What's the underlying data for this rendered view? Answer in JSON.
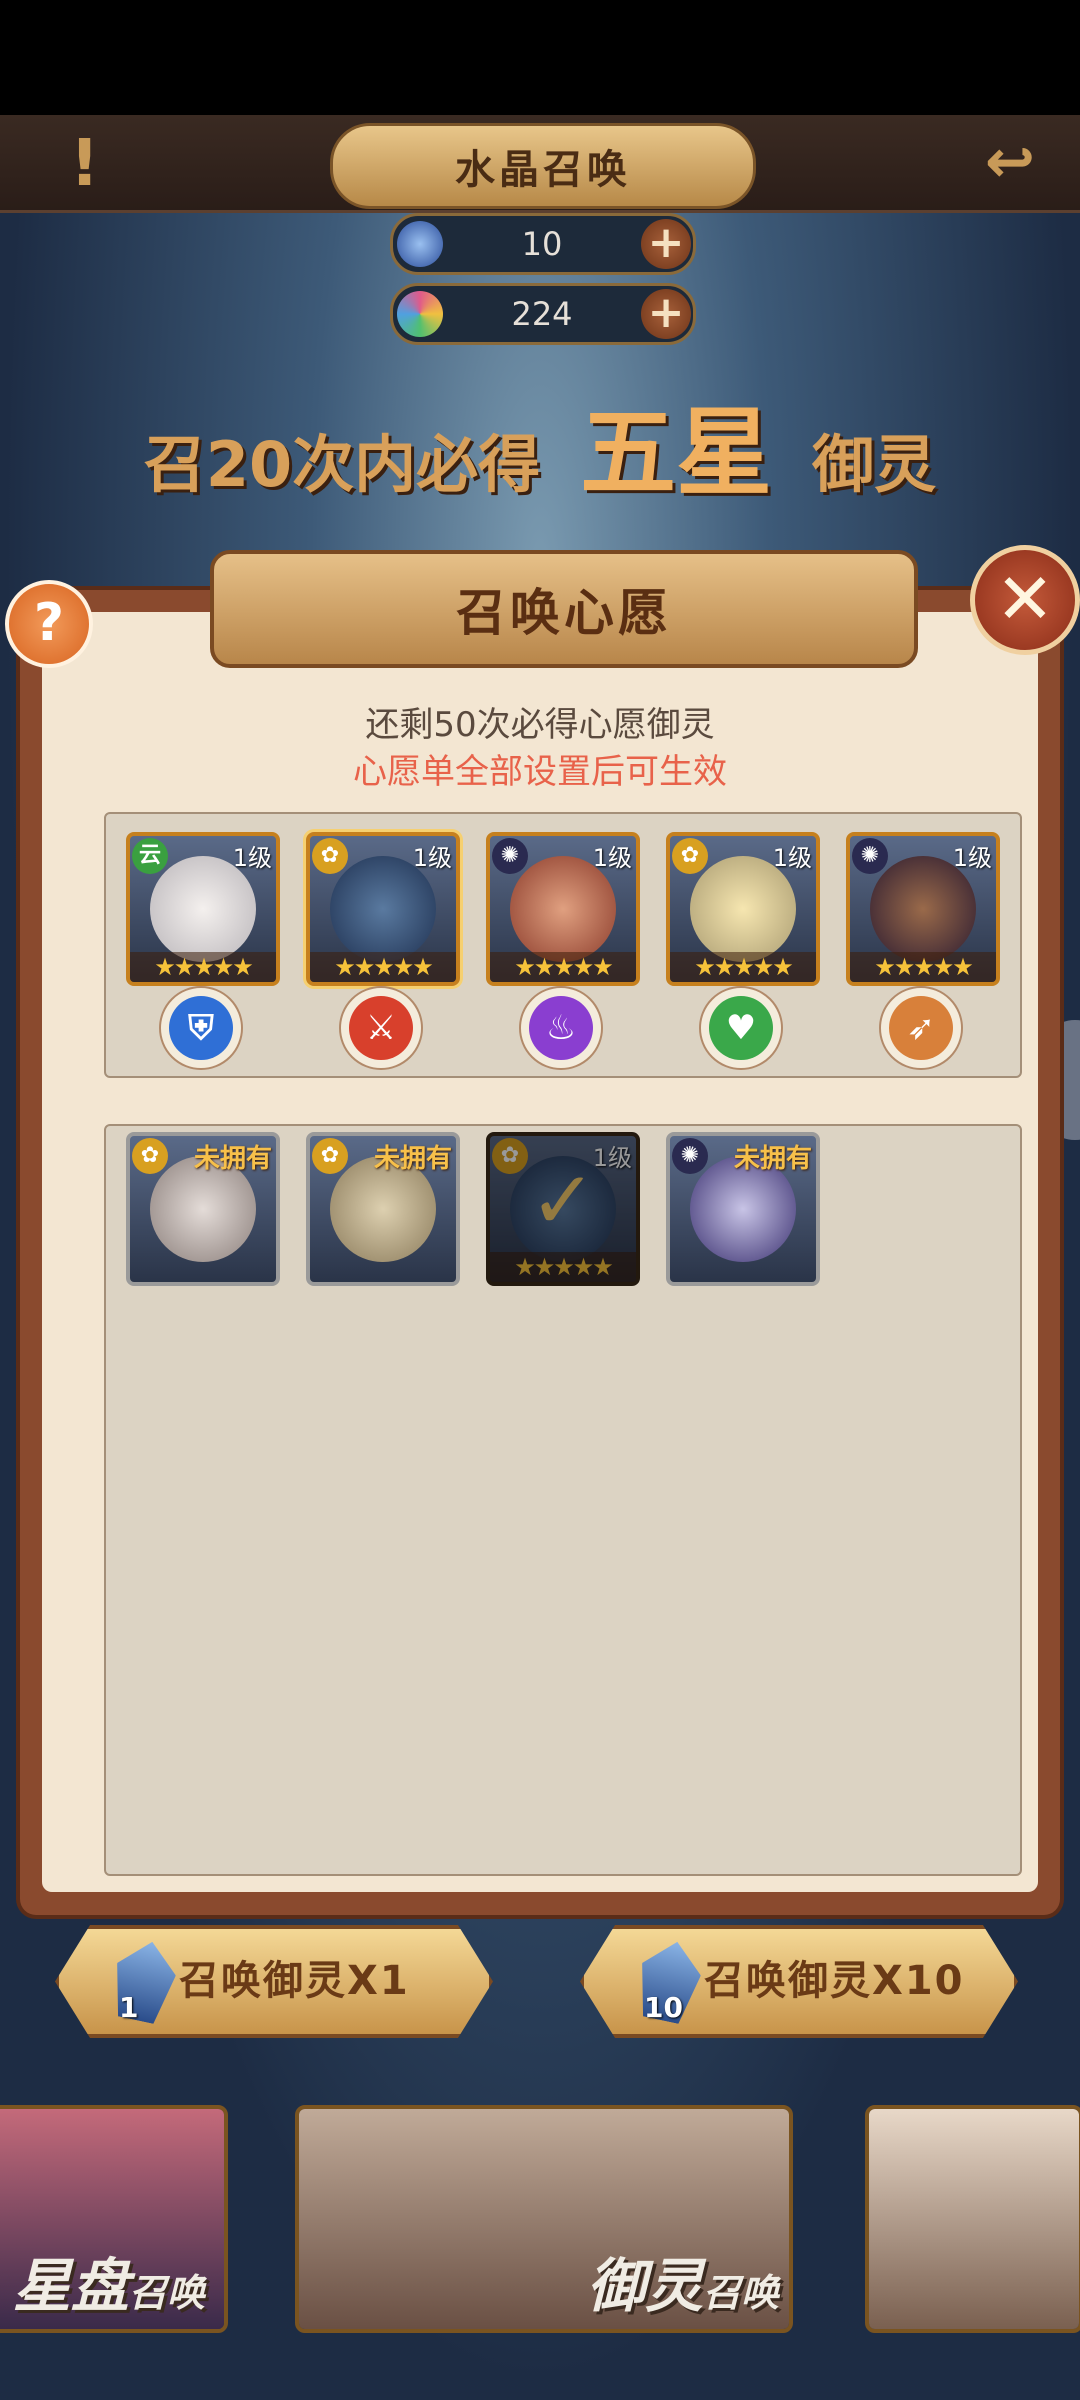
{
  "header": {
    "title": "水晶召唤",
    "alert_icon": "exclamation-icon",
    "back_icon": "back-arrow-icon"
  },
  "currency": [
    {
      "icon": "blue-crystal-icon",
      "value": "10",
      "add_label": "+"
    },
    {
      "icon": "rainbow-crystal-icon",
      "value": "224",
      "add_label": "+"
    }
  ],
  "banner": {
    "prefix": "召20次内必得",
    "highlight": "五星",
    "suffix": "御灵"
  },
  "dialog": {
    "title": "召唤心愿",
    "help_label": "?",
    "close_label": "✕",
    "remaining_text": "还剩50次必得心愿御灵",
    "hint_text": "心愿单全部设置后可生效",
    "wish_list": [
      {
        "level": "1级",
        "stars": "★★★★★",
        "element": "wind",
        "element_glyph": "云",
        "class_icon": "shield-class-icon",
        "class_glyph": "⛨",
        "class_color": "#2f6fd6"
      },
      {
        "level": "1级",
        "stars": "★★★★★",
        "element": "gold",
        "element_glyph": "✿",
        "class_icon": "sword-class-icon",
        "class_glyph": "⚔",
        "class_color": "#d8402c"
      },
      {
        "level": "1级",
        "stars": "★★★★★",
        "element": "dark",
        "element_glyph": "✺",
        "class_icon": "fire-class-icon",
        "class_glyph": "♨",
        "class_color": "#8a3ed0"
      },
      {
        "level": "1级",
        "stars": "★★★★★",
        "element": "gold",
        "element_glyph": "✿",
        "class_icon": "heal-class-icon",
        "class_glyph": "♥",
        "class_color": "#3aa84a"
      },
      {
        "level": "1级",
        "stars": "★★★★★",
        "element": "dark",
        "element_glyph": "✺",
        "class_icon": "bow-class-icon",
        "class_glyph": "➶",
        "class_color": "#d8803a"
      }
    ],
    "pool": [
      {
        "tag": "未拥有",
        "element_glyph": "✿"
      },
      {
        "tag": "未拥有",
        "element_glyph": "✿"
      },
      {
        "level": "1级",
        "stars": "★★★★★",
        "element_glyph": "✿",
        "checked": "✓"
      },
      {
        "tag": "未拥有",
        "element_glyph": "✺"
      }
    ]
  },
  "summon": [
    {
      "label": "召唤御灵X1",
      "count": "1"
    },
    {
      "label": "召唤御灵X10",
      "count": "10"
    }
  ],
  "tabs": [
    {
      "main": "星盘",
      "small": "召唤"
    },
    {
      "main": "御灵",
      "small": "召唤"
    },
    {
      "main": "",
      "small": ""
    }
  ],
  "colors": {
    "accent": "#e8624a",
    "frame": "#8a4a2e",
    "panel": "#f3e6d2"
  }
}
